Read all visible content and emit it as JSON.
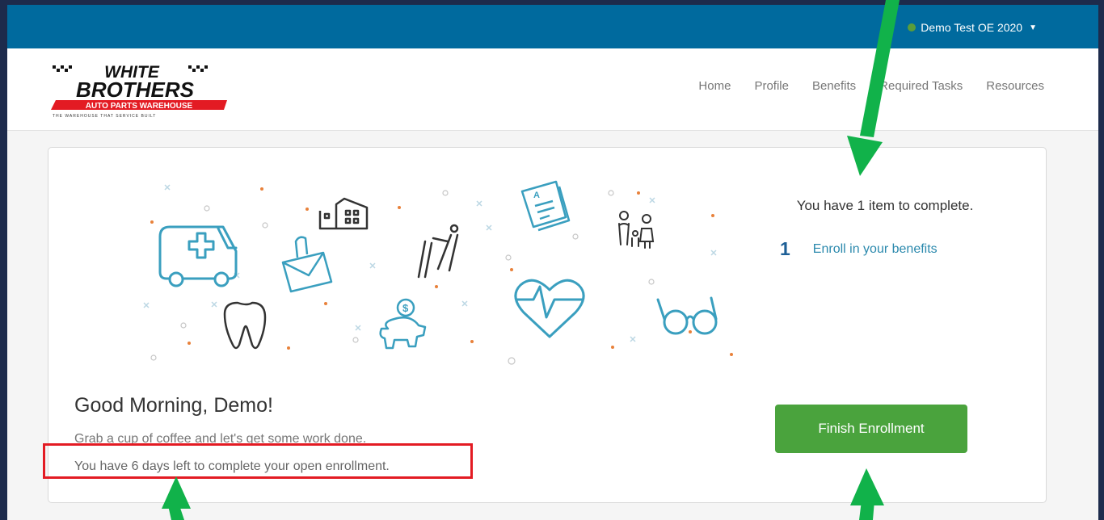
{
  "header": {
    "user_name": "Demo Test OE 2020",
    "nav": [
      "Home",
      "Profile",
      "Benefits",
      "Required Tasks",
      "Resources"
    ]
  },
  "logo": {
    "line1": "WHITE",
    "line2": "BROTHERS",
    "line3": "AUTO PARTS WAREHOUSE",
    "tagline": "THE WAREHOUSE THAT SERVICE BUILT"
  },
  "main": {
    "greeting": "Good Morning, Demo!",
    "subtext": "Grab a cup of coffee and let's get some work done.",
    "deadline": "You have 6 days left to complete your open enrollment."
  },
  "tasks": {
    "title": "You have 1 item to complete.",
    "items": [
      {
        "number": "1",
        "label": "Enroll in your benefits"
      }
    ]
  },
  "finish_button": "Finish Enrollment",
  "colors": {
    "topbar": "#006a9e",
    "button": "#4aa33d",
    "icon_teal": "#3a9fbf",
    "highlight_box": "#e31b23",
    "annotation_arrow": "#11b24a"
  }
}
